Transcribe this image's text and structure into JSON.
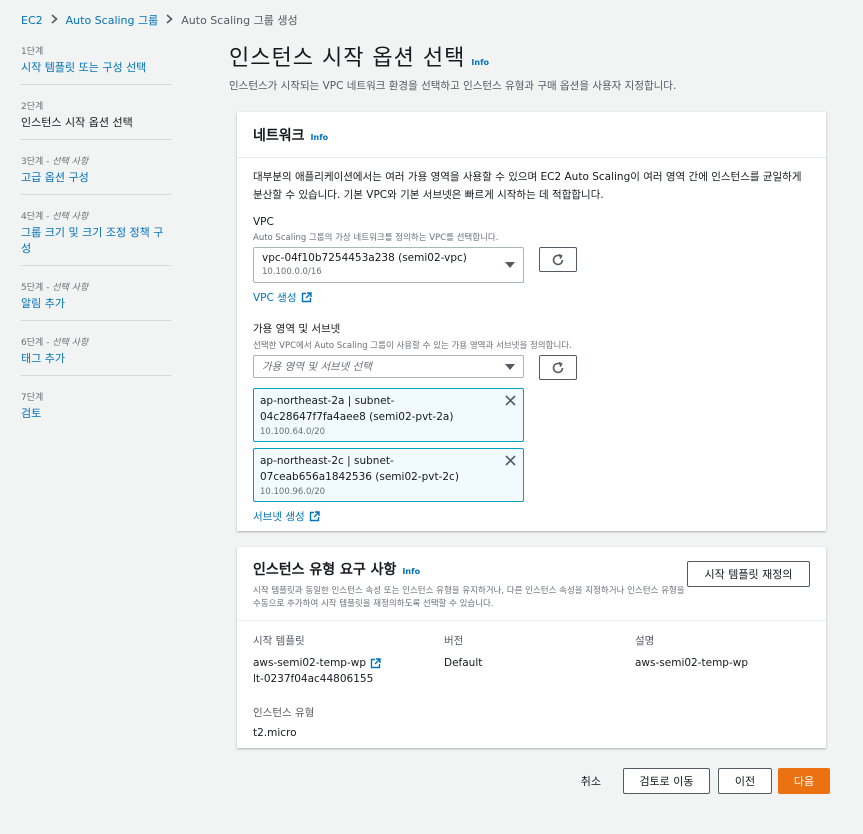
{
  "breadcrumb": {
    "ec2": "EC2",
    "asg": "Auto Scaling 그룹",
    "current": "Auto Scaling 그룹 생성"
  },
  "steps": [
    {
      "num": "1단계",
      "optional": "",
      "label": "시작 템플릿 또는 구성 선택"
    },
    {
      "num": "2단계",
      "optional": "",
      "label": "인스턴스 시작 옵션 선택"
    },
    {
      "num": "3단계 - ",
      "optional": "선택 사항",
      "label": "고급 옵션 구성"
    },
    {
      "num": "4단계 - ",
      "optional": "선택 사항",
      "label": "그룹 크기 및 크기 조정 정책 구성"
    },
    {
      "num": "5단계 - ",
      "optional": "선택 사항",
      "label": "알림 추가"
    },
    {
      "num": "6단계 - ",
      "optional": "선택 사항",
      "label": "태그 추가"
    },
    {
      "num": "7단계",
      "optional": "",
      "label": "검토"
    }
  ],
  "page": {
    "title": "인스턴스 시작 옵션 선택",
    "info": "Info",
    "desc": "인스턴스가 시작되는 VPC 네트워크 환경을 선택하고 인스턴스 유형과 구매 옵션을 사용자 지정합니다."
  },
  "network": {
    "title": "네트워크",
    "info": "Info",
    "intro": "대부분의 애플리케이션에서는 여러 가용 영역을 사용할 수 있으며 EC2 Auto Scaling이 여러 영역 간에 인스턴스를 균일하게 분산할 수 있습니다. 기본 VPC와 기본 서브넷은 빠르게 시작하는 데 적합합니다.",
    "vpc_label": "VPC",
    "vpc_desc": "Auto Scaling 그룹의 가상 네트워크를 정의하는 VPC를 선택합니다.",
    "vpc_value": "vpc-04f10b7254453a238 (semi02-vpc)",
    "vpc_cidr": "10.100.0.0/16",
    "vpc_create": "VPC 생성",
    "az_label": "가용 영역 및 서브넷",
    "az_desc": "선택한 VPC에서 Auto Scaling 그룹이 사용할 수 있는 가용 영역과 서브넷을 정의합니다.",
    "az_placeholder": "가용 영역 및 서브넷 선택",
    "subnets": [
      {
        "main": "ap-northeast-2a | subnet-04c28647f7fa4aee8 (semi02-pvt-2a)",
        "cidr": "10.100.64.0/20"
      },
      {
        "main": "ap-northeast-2c | subnet-07ceab656a1842536 (semi02-pvt-2c)",
        "cidr": "10.100.96.0/20"
      }
    ],
    "subnet_create": "서브넷 생성"
  },
  "instance_req": {
    "title": "인스턴스 유형 요구 사항",
    "info": "Info",
    "desc": "시작 템플릿과 동일한 인스턴스 속성 또는 인스턴스 유형을 유지하거나, 다른 인스턴스 속성을 지정하거나 인스턴스 유형을 수동으로 추가하여 시작 템플릿을 재정의하도록 선택할 수 있습니다.",
    "override_btn": "시작 템플릿 재정의",
    "lt_label": "시작 템플릿",
    "lt_name": "aws-semi02-temp-wp",
    "lt_id": "lt-0237f04ac44806155",
    "version_label": "버전",
    "version_value": "Default",
    "desc_label": "설명",
    "desc_value": "aws-semi02-temp-wp",
    "type_label": "인스턴스 유형",
    "type_value": "t2.micro"
  },
  "footer": {
    "cancel": "취소",
    "review": "검토로 이동",
    "prev": "이전",
    "next": "다음"
  },
  "colors": {
    "link": "#0073bb",
    "primary": "#ec7211",
    "token_bg": "#f1faff",
    "token_border": "#00a1c9"
  }
}
